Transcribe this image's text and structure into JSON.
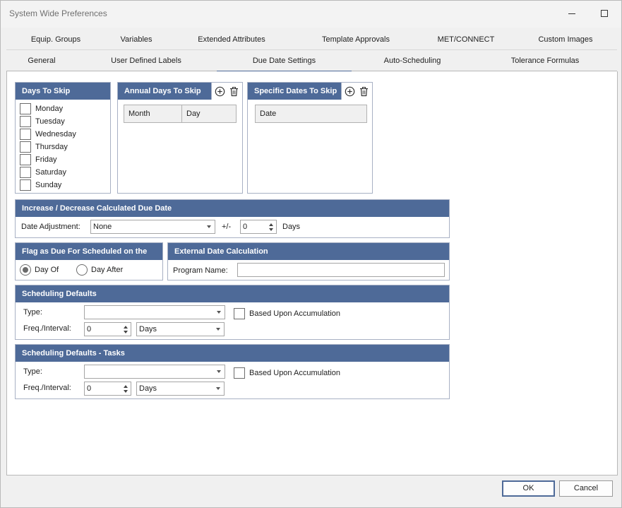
{
  "window": {
    "title": "System Wide Preferences"
  },
  "tabs_row1": [
    "Equip. Groups",
    "Variables",
    "Extended Attributes",
    "Template Approvals",
    "MET/CONNECT",
    "Custom Images"
  ],
  "tabs_row2": [
    "General",
    "User Defined Labels",
    "Due Date Settings",
    "Auto-Scheduling",
    "Tolerance Formulas"
  ],
  "active_tab": "Due Date Settings",
  "days_to_skip": {
    "title": "Days To Skip",
    "days": [
      "Monday",
      "Tuesday",
      "Wednesday",
      "Thursday",
      "Friday",
      "Saturday",
      "Sunday"
    ]
  },
  "annual_days": {
    "title": "Annual Days To Skip",
    "columns": [
      "Month",
      "Day"
    ]
  },
  "specific_dates": {
    "title": "Specific Dates To Skip",
    "columns": [
      "Date"
    ]
  },
  "adjust": {
    "title": "Increase / Decrease Calculated Due Date",
    "label": "Date Adjustment:",
    "value": "None",
    "plusminus": "+/-",
    "days_value": "0",
    "unit": "Days"
  },
  "flag": {
    "title": "Flag as Due For Scheduled on the",
    "options": [
      "Day Of",
      "Day After"
    ],
    "selected": "Day Of"
  },
  "external": {
    "title": "External Date Calculation",
    "label": "Program Name:",
    "value": ""
  },
  "sched_defaults": {
    "title": "Scheduling Defaults",
    "type_label": "Type:",
    "type_value": "",
    "accum_label": "Based Upon Accumulation",
    "freq_label": "Freq./Interval:",
    "freq_value": "0",
    "unit_value": "Days"
  },
  "sched_tasks": {
    "title": "Scheduling Defaults - Tasks",
    "type_label": "Type:",
    "type_value": "",
    "accum_label": "Based Upon Accumulation",
    "freq_label": "Freq./Interval:",
    "freq_value": "0",
    "unit_value": "Days"
  },
  "buttons": {
    "ok": "OK",
    "cancel": "Cancel"
  },
  "icons": {
    "add": "add-circle-icon",
    "delete": "trash-icon",
    "minimize": "minimize-icon",
    "maximize": "maximize-icon"
  },
  "colors": {
    "header": "#4e6a98",
    "active_tab": "#4e6a98"
  }
}
